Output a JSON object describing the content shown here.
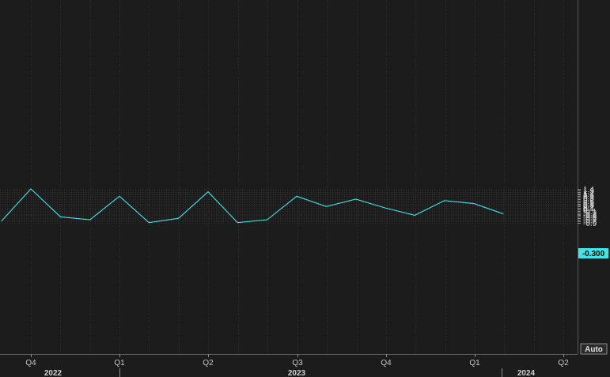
{
  "chart_data": {
    "type": "line",
    "grid": true,
    "y_axis_side": "right",
    "ylim": [
      -1.0,
      1.45
    ],
    "y_ticks": [
      "1.4",
      "1.3",
      "1.2",
      "1.1",
      "1",
      "0.9",
      "0.8",
      "0.7",
      "0.6",
      "0.5",
      "0.4",
      "0.3",
      "0.2",
      "0.1",
      "0",
      "-0.1",
      "-0.2",
      "-0.3",
      "-0.4",
      "-0.5",
      "-0.6",
      "-0.7",
      "-0.8",
      "-0.9"
    ],
    "x_quarter_labels": [
      "Q4",
      "Q1",
      "Q2",
      "Q3",
      "Q4",
      "Q1",
      "Q2"
    ],
    "x_year_labels": [
      "2022",
      "2023",
      "2024"
    ],
    "series": [
      {
        "color": "#3ee6e6",
        "values": [
          -0.8,
          1.4,
          -0.5,
          -0.7,
          0.9,
          -0.9,
          -0.6,
          1.2,
          -0.9,
          -0.7,
          0.9,
          0.2,
          0.7,
          0.1,
          -0.4,
          0.6,
          0.4,
          -0.3
        ]
      }
    ],
    "last_value_label": "-0.300",
    "scale_mode_label": "Auto"
  }
}
